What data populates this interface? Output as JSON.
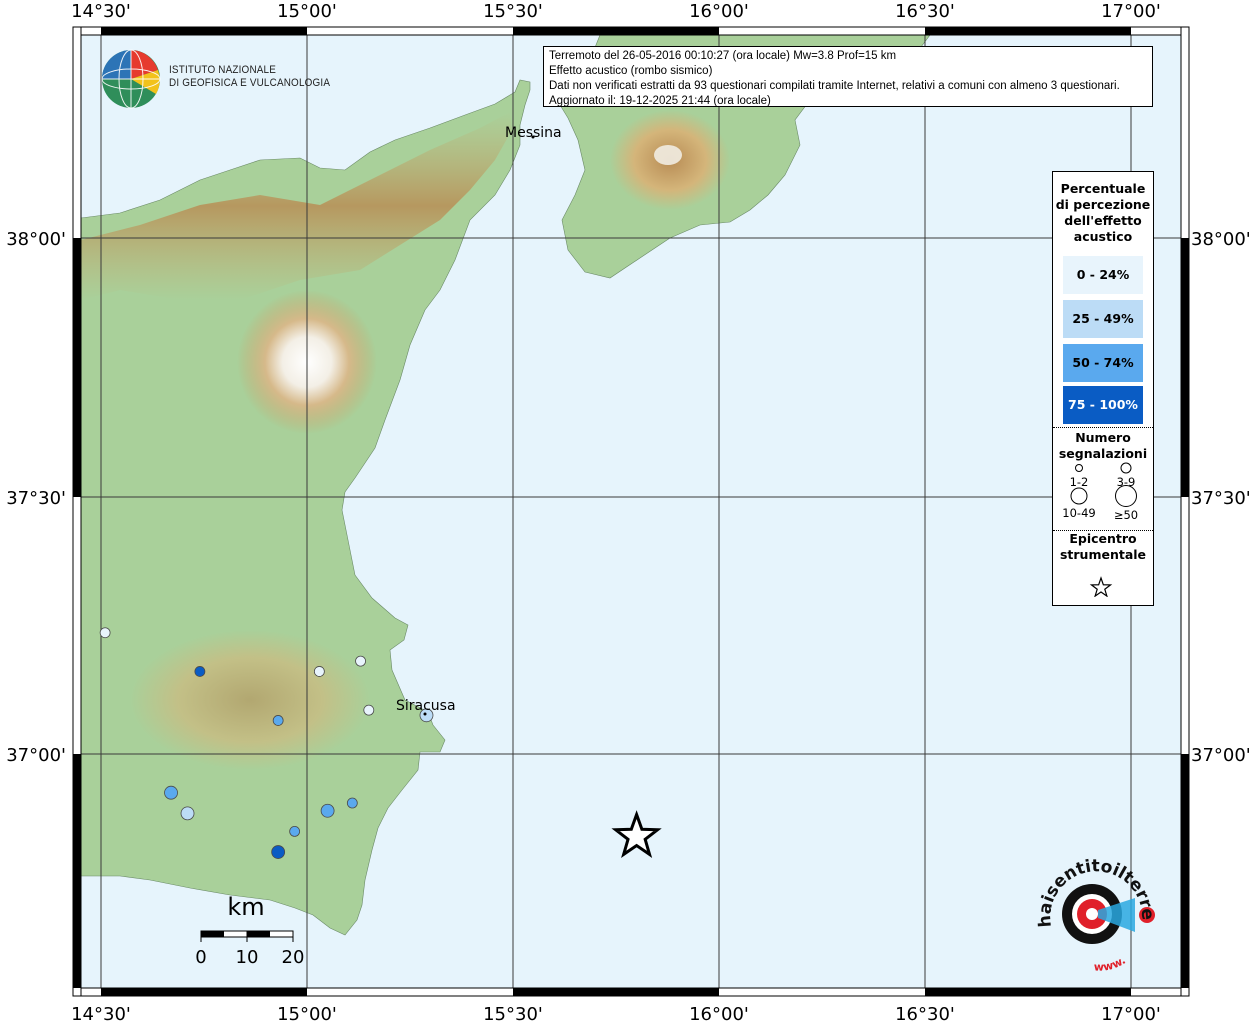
{
  "institute": {
    "line1": "ISTITUTO NAZIONALE",
    "line2": "DI GEOFISICA E VULCANOLOGIA"
  },
  "info": {
    "line1": "Terremoto del 26-05-2016 00:10:27 (ora locale) Mw=3.8 Prof=15 km",
    "line2": "Effetto acustico (rombo sismico)",
    "line3": "Dati non verificati estratti da 93 questionari compilati tramite Internet, relativi a comuni con almeno 3 questionari.",
    "line4": "Aggiornato il: 19-12-2025 21:44 (ora locale)"
  },
  "axes": {
    "lon_ticks": [
      "14°30'",
      "15°00'",
      "15°30'",
      "16°00'",
      "16°30'",
      "17°00'"
    ],
    "lat_ticks": [
      "38°00'",
      "37°30'",
      "37°00'"
    ]
  },
  "places": [
    {
      "name": "Messina"
    },
    {
      "name": "Siracusa"
    }
  ],
  "scale_bar": {
    "unit": "km",
    "labels": [
      "0",
      "10",
      "20"
    ]
  },
  "legend": {
    "title_lines": [
      "Percentuale",
      "di percezione",
      "dell'effetto",
      "acustico"
    ],
    "classes": [
      {
        "label": "0 - 24%",
        "color": "#e8f4fc"
      },
      {
        "label": "25 - 49%",
        "color": "#bcdcf6"
      },
      {
        "label": "50 - 74%",
        "color": "#5aa9ee"
      },
      {
        "label": "75 - 100%",
        "color": "#0a5cc4"
      }
    ],
    "count_title_lines": [
      "Numero",
      "segnalazioni"
    ],
    "counts": [
      "1-2",
      "3-9",
      "10-49",
      "≥50"
    ],
    "epicenter_title_lines": [
      "Epicentro",
      "strumentale"
    ]
  },
  "website": {
    "text": "haisentitoilterremoto.it",
    "url_label": "www."
  },
  "observations": [
    {
      "lon": 14.51,
      "lat": 37.235,
      "class": 0,
      "size": 1
    },
    {
      "lon": 14.74,
      "lat": 37.16,
      "class": 3,
      "size": 1
    },
    {
      "lon": 15.03,
      "lat": 37.16,
      "class": 0,
      "size": 1
    },
    {
      "lon": 15.13,
      "lat": 37.18,
      "class": 0,
      "size": 1
    },
    {
      "lon": 15.15,
      "lat": 37.085,
      "class": 0,
      "size": 1
    },
    {
      "lon": 15.29,
      "lat": 37.075,
      "class": 1,
      "size": 2
    },
    {
      "lon": 14.93,
      "lat": 37.065,
      "class": 2,
      "size": 1
    },
    {
      "lon": 14.67,
      "lat": 36.925,
      "class": 2,
      "size": 2
    },
    {
      "lon": 14.71,
      "lat": 36.885,
      "class": 1,
      "size": 2
    },
    {
      "lon": 15.11,
      "lat": 36.905,
      "class": 2,
      "size": 1
    },
    {
      "lon": 15.05,
      "lat": 36.89,
      "class": 2,
      "size": 2
    },
    {
      "lon": 14.97,
      "lat": 36.85,
      "class": 2,
      "size": 1
    },
    {
      "lon": 14.93,
      "lat": 36.81,
      "class": 3,
      "size": 2
    }
  ],
  "epicenter": {
    "lon": 15.8,
    "lat": 36.84
  },
  "colors": {
    "sea": "#e6f4fc",
    "frame": "#000000",
    "grid": "#3a3a3a",
    "land_low": "#a9d09a",
    "land_mid": "#d8c48a",
    "land_high": "#b48a4c"
  }
}
